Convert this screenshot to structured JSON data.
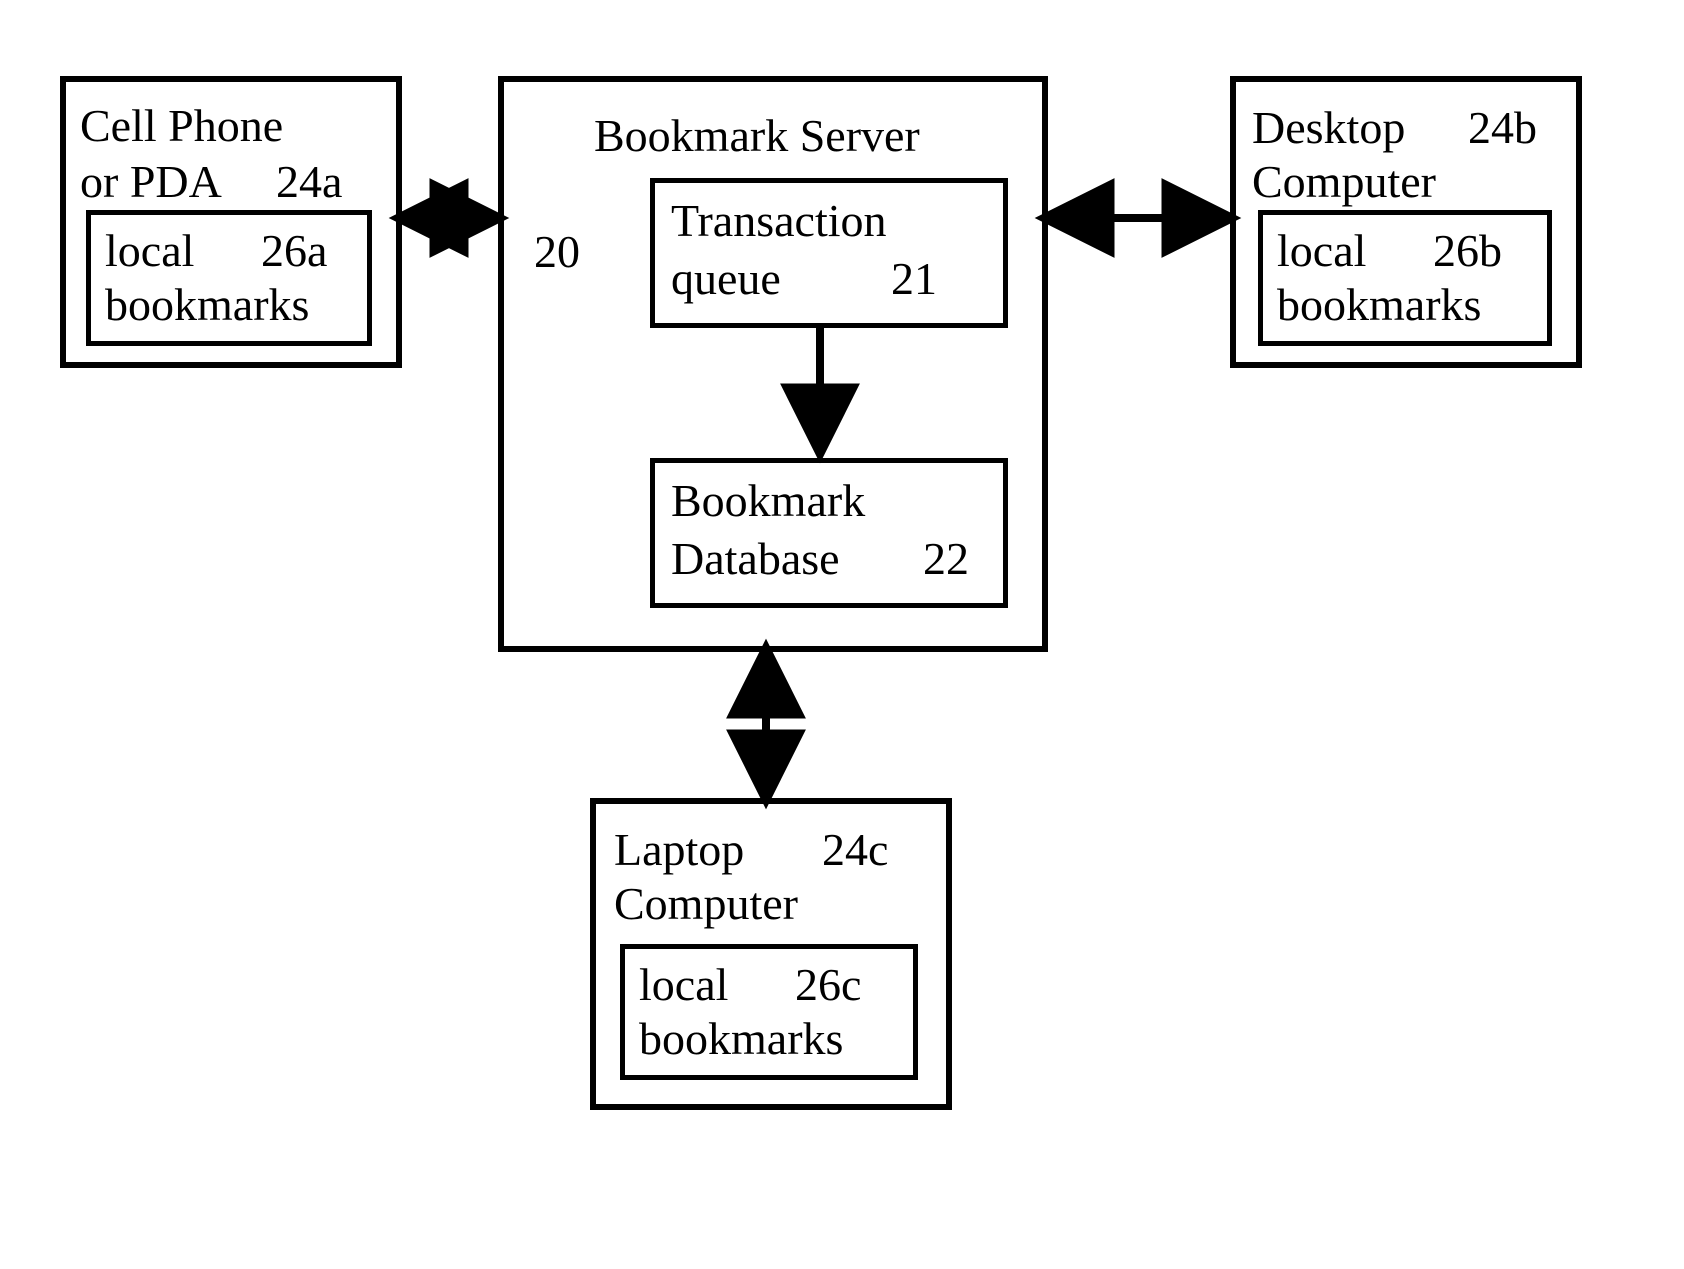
{
  "nodes": {
    "cellphone": {
      "title_l1": "Cell Phone",
      "title_l2": "or PDA",
      "ref": "24a",
      "inner_l1": "local",
      "inner_ref": "26a",
      "inner_l2": "bookmarks"
    },
    "desktop": {
      "title_l1": "Desktop",
      "title_l2": "Computer",
      "ref": "24b",
      "inner_l1": "local",
      "inner_ref": "26b",
      "inner_l2": "bookmarks"
    },
    "laptop": {
      "title_l1": "Laptop",
      "title_l2": "Computer",
      "ref": "24c",
      "inner_l1": "local",
      "inner_ref": "26c",
      "inner_l2": "bookmarks"
    },
    "server": {
      "title": "Bookmark Server",
      "ref": "20",
      "txq_l1": "Transaction",
      "txq_l2": "queue",
      "txq_ref": "21",
      "db_l1": "Bookmark",
      "db_l2": "Database",
      "db_ref": "22"
    }
  }
}
